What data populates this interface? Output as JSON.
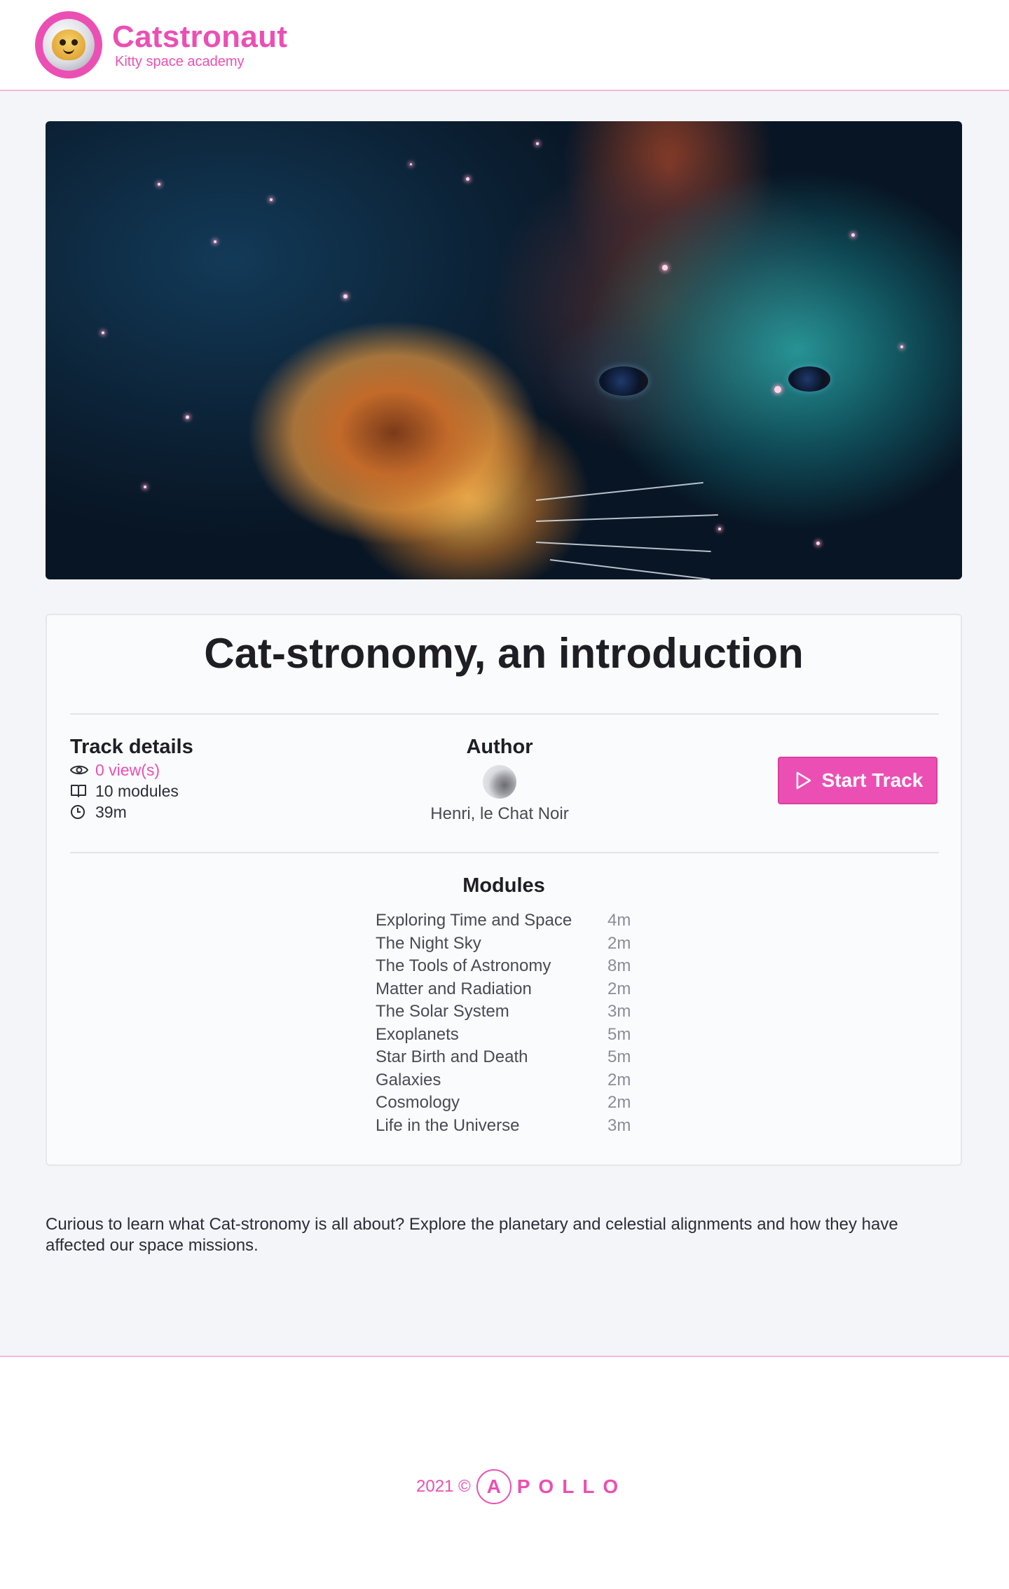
{
  "header": {
    "brand_title": "Catstronaut",
    "brand_subtitle": "Kitty space academy",
    "brand_color": "#ec4fb4"
  },
  "track": {
    "title": "Cat-stronomy, an introduction",
    "details_heading": "Track details",
    "views": "0 view(s)",
    "modules_count": "10 modules",
    "length": "39m",
    "author_heading": "Author",
    "author_name": "Henri, le Chat Noir",
    "start_label": "Start Track",
    "modules_heading": "Modules",
    "modules": [
      {
        "title": "Exploring Time and Space",
        "length": "4m"
      },
      {
        "title": "The Night Sky",
        "length": "2m"
      },
      {
        "title": "The Tools of Astronomy",
        "length": "8m"
      },
      {
        "title": "Matter and Radiation",
        "length": "2m"
      },
      {
        "title": "The Solar System",
        "length": "3m"
      },
      {
        "title": "Exoplanets",
        "length": "5m"
      },
      {
        "title": "Star Birth and Death",
        "length": "5m"
      },
      {
        "title": "Galaxies",
        "length": "2m"
      },
      {
        "title": "Cosmology",
        "length": "2m"
      },
      {
        "title": "Life in the Universe",
        "length": "3m"
      }
    ],
    "description": "Curious to learn what Cat-stronomy is all about? Explore the planetary and celestial alignments and how they have affected our space missions."
  },
  "footer": {
    "year": "2021 ©",
    "brand": "APOLLO"
  },
  "icons": [
    "eye-icon",
    "book-icon",
    "clock-icon",
    "play-icon"
  ]
}
